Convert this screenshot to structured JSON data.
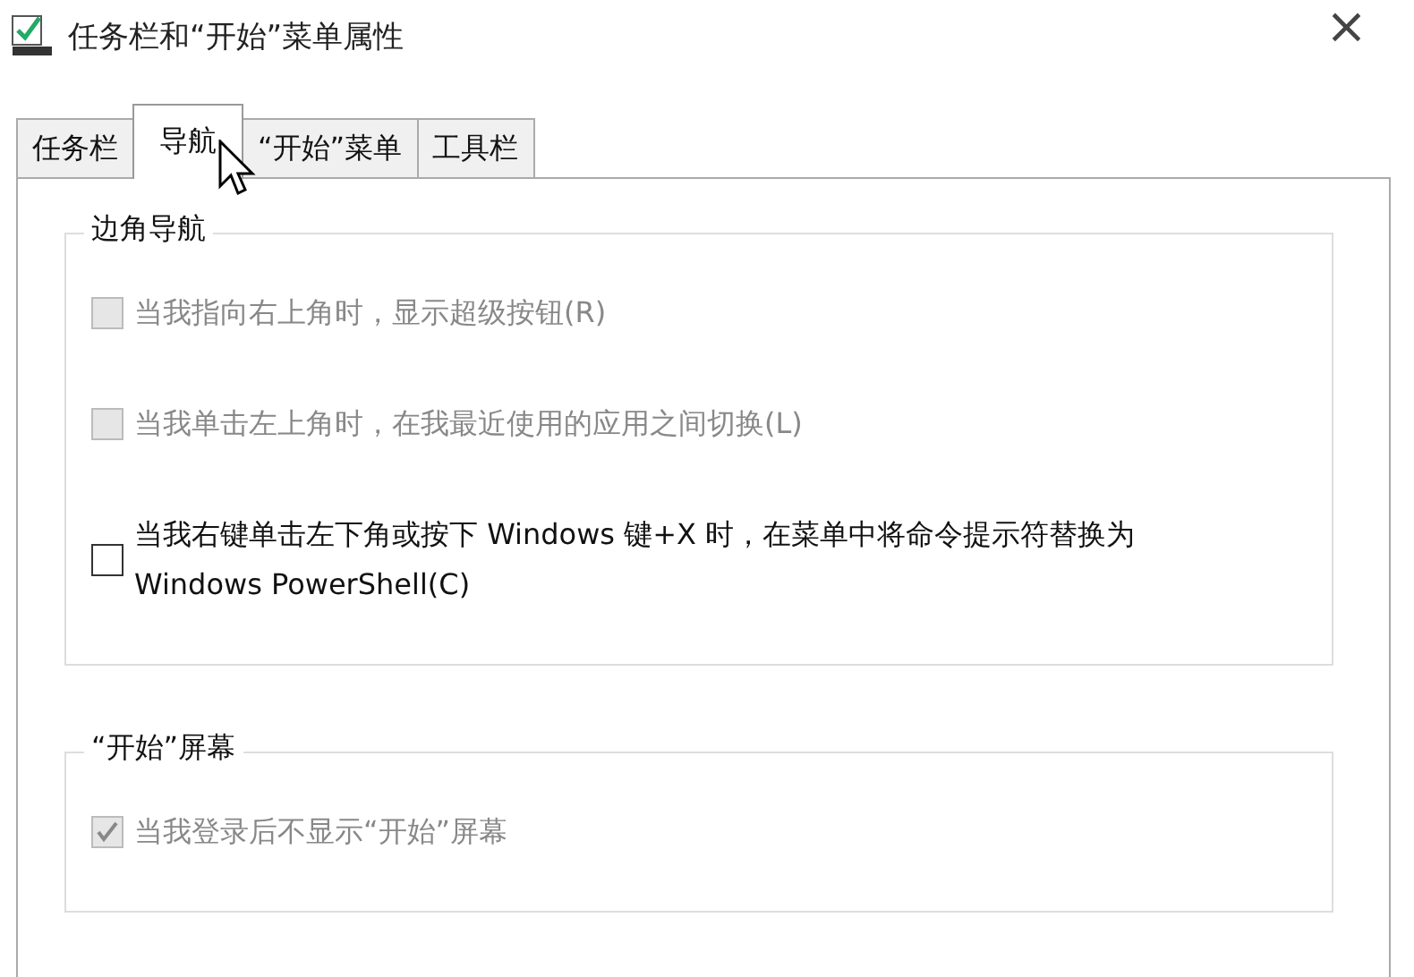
{
  "window": {
    "title": "任务栏和“开始”菜单属性",
    "close": "×"
  },
  "tabs": [
    {
      "label": "任务栏",
      "selected": false
    },
    {
      "label": "导航",
      "selected": true
    },
    {
      "label": "“开始”菜单",
      "selected": false
    },
    {
      "label": "工具栏",
      "selected": false
    }
  ],
  "groups": [
    {
      "title": "边角导航",
      "options": [
        {
          "label": "当我指向右上角时，显示超级按钮(R)",
          "checked": false,
          "disabled": true
        },
        {
          "label": "当我单击左上角时，在我最近使用的应用之间切换(L)",
          "checked": false,
          "disabled": true
        },
        {
          "label": "当我右键单击左下角或按下 Windows 键+X 时，在菜单中将命令提示符替换为 Windows PowerShell(C)",
          "checked": false,
          "disabled": false
        }
      ]
    },
    {
      "title": "“开始”屏幕",
      "options": [
        {
          "label": "当我登录后不显示“开始”屏幕",
          "checked": true,
          "disabled": true
        }
      ]
    }
  ]
}
